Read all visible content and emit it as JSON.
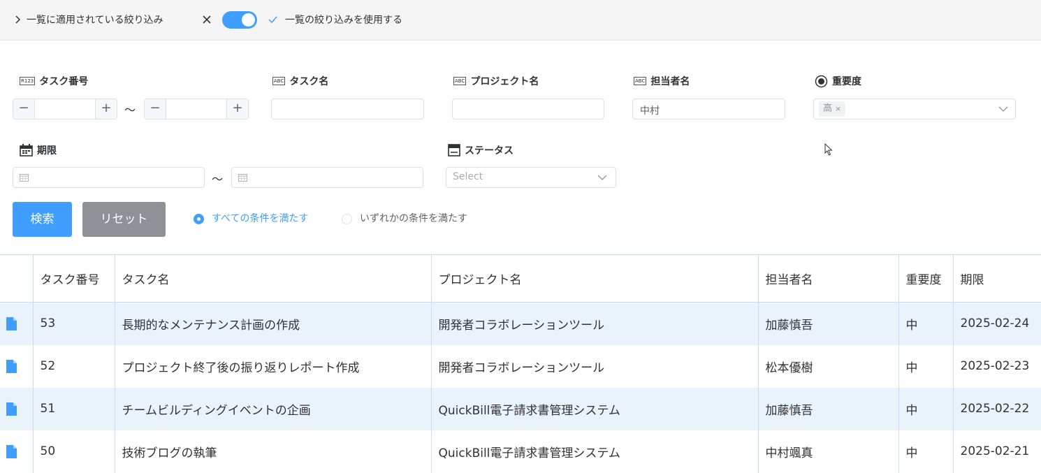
{
  "topbar": {
    "applied_filters_label": "一覧に適用されている絞り込み",
    "use_filter_label": "一覧の絞り込みを使用する"
  },
  "filters": {
    "task_number": {
      "label": "タスク番号",
      "type_badge": "R123",
      "from_value": "",
      "to_value": "",
      "minus": "−",
      "plus": "+"
    },
    "task_name": {
      "label": "タスク名",
      "type_badge": "ABC",
      "value": ""
    },
    "project_name": {
      "label": "プロジェクト名",
      "type_badge": "ABC",
      "value": ""
    },
    "assignee": {
      "label": "担当者名",
      "type_badge": "ABC",
      "value": "中村"
    },
    "priority": {
      "label": "重要度",
      "selected_tag": "高",
      "tag_close": "×"
    },
    "due_date": {
      "label": "期限",
      "from_value": "",
      "to_value": ""
    },
    "status": {
      "label": "ステータス",
      "placeholder": "Select"
    },
    "range_separator": "〜"
  },
  "actions": {
    "search_label": "検索",
    "reset_label": "リセット",
    "match_all_label": "すべての条件を満たす",
    "match_any_label": "いずれかの条件を満たす"
  },
  "table": {
    "headers": [
      "タスク番号",
      "タスク名",
      "プロジェクト名",
      "担当者名",
      "重要度",
      "期限"
    ],
    "rows": [
      {
        "id": "53",
        "task": "長期的なメンテナンス計画の作成",
        "project": "開発者コラボレーションツール",
        "assignee": "加藤慎吾",
        "priority": "中",
        "due": "2025-02-24"
      },
      {
        "id": "52",
        "task": "プロジェクト終了後の振り返りレポート作成",
        "project": "開発者コラボレーションツール",
        "assignee": "松本優樹",
        "priority": "中",
        "due": "2025-02-23"
      },
      {
        "id": "51",
        "task": "チームビルディングイベントの企画",
        "project": "QuickBill電子請求書管理システム",
        "assignee": "加藤慎吾",
        "priority": "中",
        "due": "2025-02-22"
      },
      {
        "id": "50",
        "task": "技術ブログの執筆",
        "project": "QuickBill電子請求書管理システム",
        "assignee": "中村颯真",
        "priority": "中",
        "due": "2025-02-21"
      }
    ]
  },
  "colors": {
    "accent": "#409eff",
    "reset_button": "#8e9196",
    "row_alt": "#eaf3fc",
    "grid_line": "#c9dcef"
  }
}
